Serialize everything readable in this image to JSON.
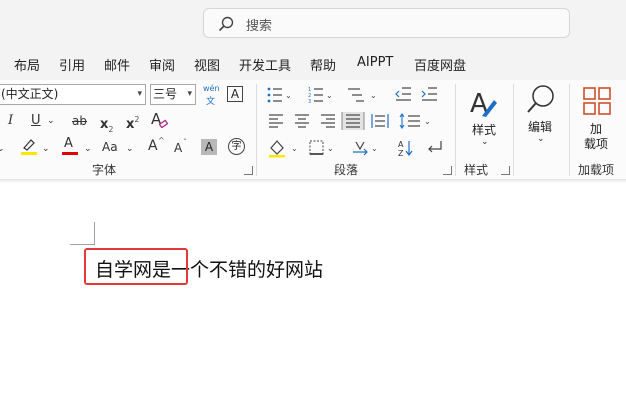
{
  "title_bar": {
    "search_placeholder": "搜索"
  },
  "tabs": [
    "布局",
    "引用",
    "邮件",
    "审阅",
    "视图",
    "开发工具",
    "帮助",
    "AIPPT",
    "百度网盘"
  ],
  "font_group": {
    "font_name": "(中文正文)",
    "font_size": "三号",
    "phonetic_top": "wén",
    "phonetic_bottom": "文",
    "char_border": "A",
    "italic": "I",
    "underline": "U",
    "strike": "ab",
    "subscript": "x",
    "sub_mark": "2",
    "superscript": "x",
    "sup_mark": "2",
    "clear": "A",
    "font_color": "A",
    "change_case": "Aa",
    "grow": "A",
    "shrink": "A",
    "shade": "A",
    "enclose": "字",
    "label": "字体"
  },
  "paragraph_group": {
    "sort_top": "A",
    "sort_bottom": "Z",
    "label": "段落"
  },
  "styles_group": {
    "button": "样式",
    "label": "样式"
  },
  "editing_group": {
    "button": "编辑"
  },
  "addins_group": {
    "button_line1": "加",
    "button_line2": "载项",
    "label": "加载项"
  },
  "colors": {
    "accent_red": "#e23a3a",
    "highlight_yellow": "#ffe800",
    "font_red": "#e00000"
  },
  "document": {
    "text": "自学网是一个不错的好网站"
  }
}
